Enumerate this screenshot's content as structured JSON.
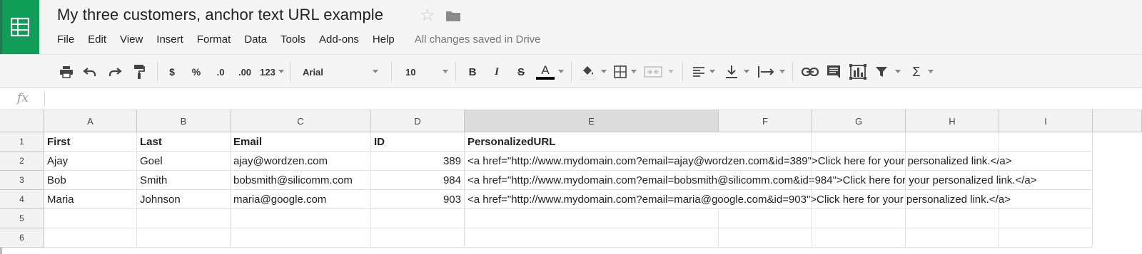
{
  "app": {
    "title": "My three customers, anchor text URL example",
    "save_status": "All changes saved in Drive",
    "star": "☆",
    "menu": [
      "File",
      "Edit",
      "View",
      "Insert",
      "Format",
      "Data",
      "Tools",
      "Add-ons",
      "Help"
    ],
    "brand_color": "#0f9d58"
  },
  "toolbar": {
    "currency": "$",
    "percent": "%",
    "dec_decrease": ".0",
    "dec_increase": ".00",
    "more_formats": "123",
    "font": "Arial",
    "font_size": "10",
    "bold": "B",
    "italic": "I",
    "strikethrough": "S",
    "text_color": "A",
    "sum": "Σ",
    "icons": [
      "print-icon",
      "undo-icon",
      "redo-icon",
      "paint-format-icon",
      "fill-color-icon",
      "borders-icon",
      "merge-cells-icon",
      "align-left-icon",
      "vertical-align-icon",
      "text-wrap-icon",
      "insert-link-icon",
      "insert-comment-icon",
      "insert-chart-icon",
      "filter-icon",
      "functions-icon"
    ]
  },
  "formula_bar": {
    "fx": "fx",
    "value": ""
  },
  "sheet": {
    "columns": [
      "A",
      "B",
      "C",
      "D",
      "E",
      "F",
      "G",
      "H",
      "I"
    ],
    "selected_column": "E",
    "row_numbers": [
      "1",
      "2",
      "3",
      "4",
      "5",
      "6"
    ],
    "rows": [
      [
        "First",
        "Last",
        "Email",
        "ID",
        "PersonalizedURL"
      ],
      [
        "Ajay",
        "Goel",
        "ajay@wordzen.com",
        "389",
        "<a href=\"http://www.mydomain.com?email=ajay@wordzen.com&id=389\">Click here for your personalized link.</a>"
      ],
      [
        "Bob",
        "Smith",
        "bobsmith@silicomm.com",
        "984",
        "<a href=\"http://www.mydomain.com?email=bobsmith@silicomm.com&id=984\">Click here for your personalized link.</a>"
      ],
      [
        "Maria",
        "Johnson",
        "maria@google.com",
        "903",
        "<a href=\"http://www.mydomain.com?email=maria@google.com&id=903\">Click here for your personalized link.</a>"
      ],
      [
        "",
        "",
        "",
        "",
        ""
      ],
      [
        "",
        "",
        "",
        "",
        ""
      ]
    ]
  }
}
